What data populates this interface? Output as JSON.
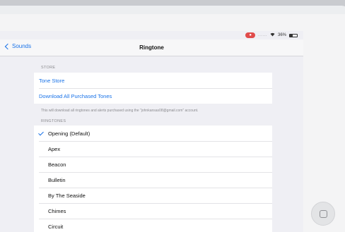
{
  "status_bar": {
    "record_label": "●",
    "dots": "......",
    "wifi_icon": "wifi-icon",
    "battery_text": "36%",
    "battery_level": 0.36
  },
  "nav": {
    "back_label": "Sounds",
    "title": "Ringtone"
  },
  "store": {
    "header": "STORE",
    "items": [
      {
        "label": "Tone Store"
      },
      {
        "label": "Download All Purchased Tones"
      }
    ],
    "footer": "This will download all ringtones and alerts purchased using the “johnkansas08@gmail.com” account."
  },
  "ringtones": {
    "header": "RINGTONES",
    "selected_index": 0,
    "items": [
      {
        "label": "Opening (Default)"
      },
      {
        "label": "Apex"
      },
      {
        "label": "Beacon"
      },
      {
        "label": "Bulletin"
      },
      {
        "label": "By The Seaside"
      },
      {
        "label": "Chimes"
      },
      {
        "label": "Circuit"
      }
    ]
  },
  "colors": {
    "accent": "#1a73e8",
    "record": "#e04b4b"
  }
}
